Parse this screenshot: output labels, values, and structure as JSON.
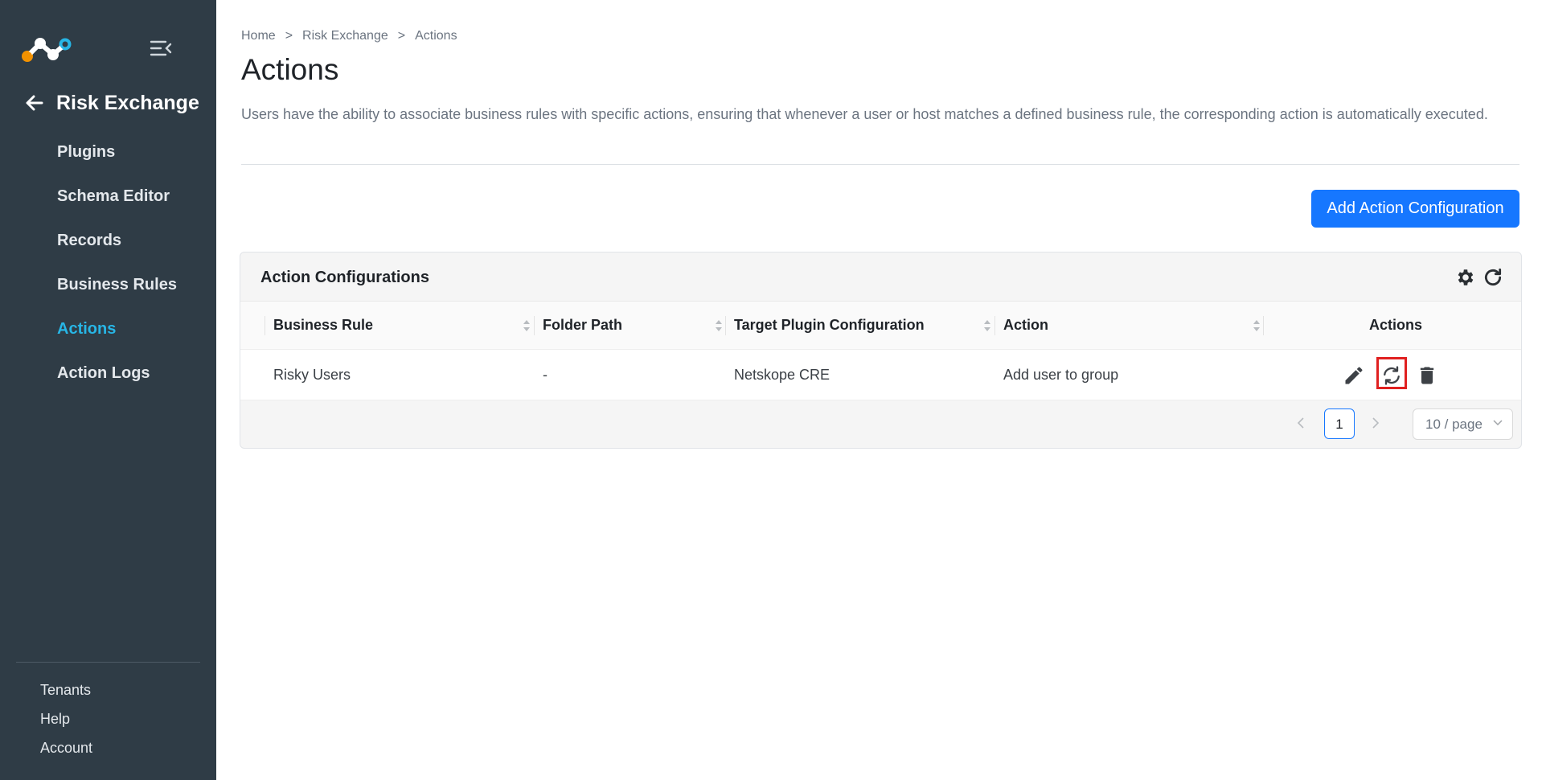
{
  "sidebar": {
    "back_title": "Risk Exchange",
    "items": [
      {
        "label": "Plugins",
        "active": false
      },
      {
        "label": "Schema Editor",
        "active": false
      },
      {
        "label": "Records",
        "active": false
      },
      {
        "label": "Business Rules",
        "active": false
      },
      {
        "label": "Actions",
        "active": true
      },
      {
        "label": "Action Logs",
        "active": false
      }
    ],
    "bottom_items": [
      {
        "label": "Tenants"
      },
      {
        "label": "Help"
      },
      {
        "label": "Account"
      }
    ],
    "icons": {
      "logo": "netskope-logo",
      "collapse": "menu-collapse-icon",
      "back": "arrow-left-icon"
    }
  },
  "breadcrumb": {
    "home": "Home",
    "section": "Risk Exchange",
    "current": "Actions",
    "separator": ">"
  },
  "page": {
    "title": "Actions",
    "description": "Users have the ability to associate business rules with specific actions, ensuring that whenever a user or host matches a defined business rule, the corresponding action is automatically executed.",
    "add_button_label": "Add Action Configuration"
  },
  "card": {
    "title": "Action Configurations",
    "columns": [
      "Business Rule",
      "Folder Path",
      "Target Plugin Configuration",
      "Action",
      "Actions"
    ],
    "rows": [
      {
        "business_rule": "Risky Users",
        "folder_path": "-",
        "target_plugin": "Netskope CRE",
        "action": "Add user to group"
      }
    ],
    "row_icons": [
      "edit-icon",
      "sync-icon",
      "delete-icon"
    ],
    "highlighted_icon": "sync-icon"
  },
  "pagination": {
    "current_page": "1",
    "page_size": "10 / page"
  },
  "colors": {
    "sidebar_bg": "#2f3c46",
    "active_nav": "#27b6e6",
    "primary": "#1677ff",
    "highlight": "#e02020"
  }
}
